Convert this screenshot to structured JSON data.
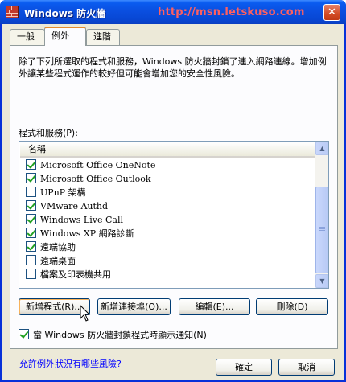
{
  "window": {
    "title": "Windows 防火牆",
    "watermark": "http://msn.letskuso.com",
    "close_label": "✕"
  },
  "tabs": [
    {
      "label": "一般",
      "active": false
    },
    {
      "label": "例外",
      "active": true
    },
    {
      "label": "進階",
      "active": false
    }
  ],
  "exceptions": {
    "description": "除了下列所選取的程式和服務，Windows 防火牆封鎖了連入網路連線。增加例外讓某些程式運作的較好但可能會增加您的安全性風險。",
    "list_label": "程式和服務(P):",
    "column_header": "名稱",
    "items": [
      {
        "label": "Microsoft Office OneNote",
        "checked": true
      },
      {
        "label": "Microsoft Office Outlook",
        "checked": true
      },
      {
        "label": "UPnP 架構",
        "checked": false
      },
      {
        "label": "VMware Authd",
        "checked": true
      },
      {
        "label": "Windows Live Call",
        "checked": true
      },
      {
        "label": "Windows XP 網路診斷",
        "checked": true
      },
      {
        "label": "遠端協助",
        "checked": true
      },
      {
        "label": "遠端桌面",
        "checked": false
      },
      {
        "label": "檔案及印表機共用",
        "checked": false
      }
    ],
    "buttons": {
      "add_program": "新增程式(R)...",
      "add_port": "新增連接埠(O)...",
      "edit": "編輯(E)...",
      "delete": "刪除(D)"
    },
    "notify_label": "當 Windows 防火牆封鎖程式時顯示通知(N)",
    "notify_checked": true,
    "risk_link": "允許例外狀況有哪些風險?"
  },
  "footer": {
    "ok_label": "確定",
    "cancel_label": "取消"
  },
  "colors": {
    "titlebar": "#0a4fe0",
    "face": "#ece9d8",
    "active_tab_accent": "#e68b2c",
    "link": "#0000ff",
    "checkmark": "#21a121"
  }
}
